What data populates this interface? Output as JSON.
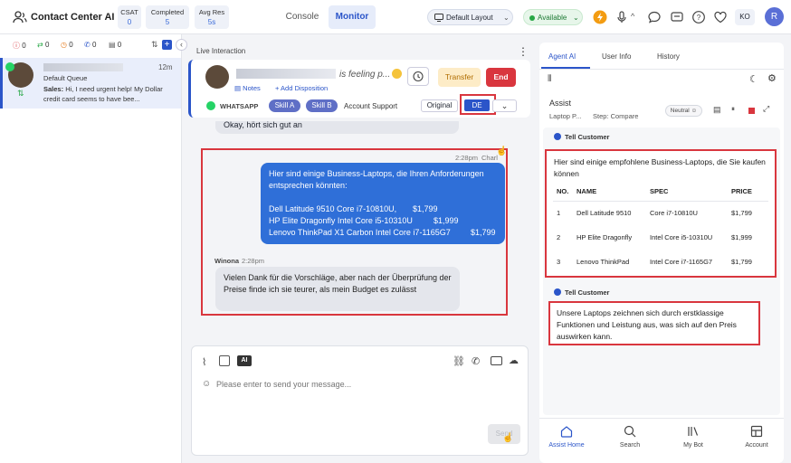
{
  "app": {
    "title": "Contact Center AI"
  },
  "stats": [
    {
      "label": "CSAT",
      "value": "0"
    },
    {
      "label": "Completed",
      "value": "5"
    },
    {
      "label": "Avg Res",
      "value": "5s"
    }
  ],
  "nav": {
    "console": "Console",
    "monitor": "Monitor"
  },
  "layout_select": "Default Layout",
  "status": "Available",
  "user_initials": "KO",
  "avatar_letter": "R",
  "left": {
    "counters": [
      "0",
      "0",
      "0",
      "0",
      "0"
    ],
    "queue_item": {
      "time": "12m",
      "queue": "Default Queue",
      "preview_label": "Sales:",
      "preview": "Hi, I need urgent help! My Dollar credit card seems to have bee..."
    }
  },
  "center": {
    "section_label": "Live Interaction",
    "customer_status": "is feeling p...",
    "notes": "Notes",
    "add_disposition": "+ Add Disposition",
    "transfer": "Transfer",
    "end": "End",
    "channel": "WHATSAPP",
    "skills": [
      "Skill A",
      "Skill B"
    ],
    "queue_name": "Account Support",
    "lang_original": "Original",
    "lang_de": "DE",
    "prev_message": "Okay, hört sich gut an",
    "agent_time": "2:28pm",
    "agent_sender": "Charl",
    "agent_message_intro": "Hier sind einige Business-Laptops, die Ihren Anforderungen entsprechen könnten:",
    "agent_message_items": [
      {
        "name": "Dell Latitude 9510 Core i7-10810U,",
        "price": "$1,799"
      },
      {
        "name": "HP Elite Dragonfly Intel Core i5-10310U",
        "price": "$1,999"
      },
      {
        "name": "Lenovo ThinkPad X1 Carbon Intel Core i7-1165G7",
        "price": "$1,799"
      }
    ],
    "customer_name": "Winona",
    "customer_time": "2:28pm",
    "customer_message": "Vielen Dank für die Vorschläge, aber nach der Überprüfung der Preise finde ich sie teurer, als mein Budget es zulässt",
    "composer_placeholder": "Please enter to send your message...",
    "send": "Send"
  },
  "right": {
    "tabs": [
      "Agent AI",
      "User Info",
      "History"
    ],
    "assist_title": "Assist",
    "assist_product": "Laptop P...",
    "assist_step": "Step: Compare",
    "sentiment": "Neutral",
    "tell_customer_label": "Tell Customer",
    "card1_text": "Hier sind einige empfohlene Business-Laptops, die Sie kaufen können",
    "table_headers": [
      "NO.",
      "NAME",
      "SPEC",
      "PRICE"
    ],
    "table_rows": [
      {
        "no": "1",
        "name": "Dell Latitude 9510",
        "spec": "Core i7-10810U",
        "price": "$1,799"
      },
      {
        "no": "2",
        "name": "HP Elite Dragonfly",
        "spec": "Intel Core i5-10310U",
        "price": "$1,999"
      },
      {
        "no": "3",
        "name": "Lenovo ThinkPad",
        "spec": "Intel Core i7-1165G7",
        "price": "$1,799"
      }
    ],
    "card2_text": "Unsere Laptops zeichnen sich durch erstklassige Funktionen und Leistung aus, was sich auf den Preis auswirken kann.",
    "bottom_nav": [
      "Assist Home",
      "Search",
      "My Bot",
      "Account"
    ]
  },
  "colors": {
    "accent": "#2b55c9",
    "danger": "#d9363e",
    "agent_bubble": "#2f6fd8"
  }
}
